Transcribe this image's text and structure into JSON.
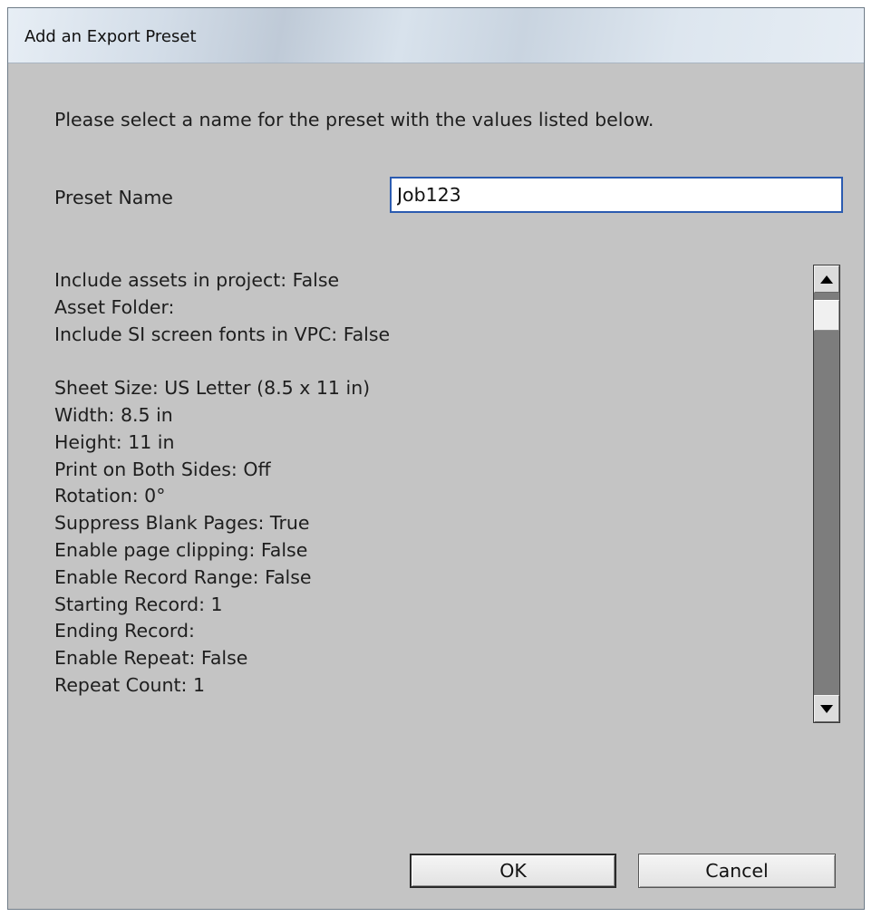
{
  "window": {
    "title": "Add an Export Preset"
  },
  "dialog": {
    "instruction": "Please select a name for the preset with the values listed below.",
    "preset_name_label": "Preset Name",
    "preset_name_value": "Job123",
    "values_text": "Include assets in project: False\nAsset Folder:\nInclude SI screen fonts in VPC: False\n\nSheet Size: US Letter (8.5 x 11 in)\nWidth: 8.5 in\nHeight: 11 in\nPrint on Both Sides: Off\nRotation: 0°\nSuppress Blank Pages: True\nEnable page clipping: False\nEnable Record Range: False\nStarting Record: 1\nEnding Record:\nEnable Repeat: False\nRepeat Count: 1"
  },
  "scrollbar": {
    "up_icon": "scroll-up-arrow",
    "down_icon": "scroll-down-arrow",
    "position": 0
  },
  "buttons": {
    "ok": "OK",
    "cancel": "Cancel"
  },
  "colors": {
    "dialog_background": "#c4c4c4",
    "input_focus_border": "#2b5bb0",
    "scrollbar_track": "#7d7d7d"
  }
}
